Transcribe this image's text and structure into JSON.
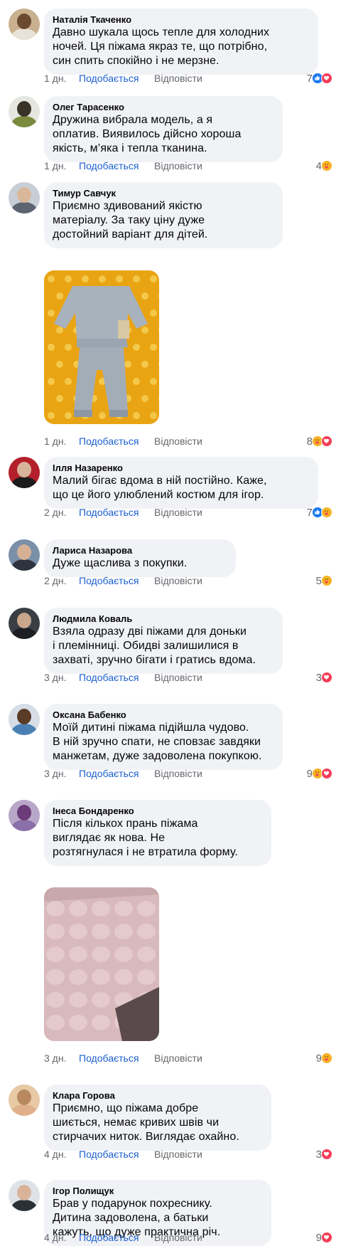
{
  "ui": {
    "like_label": "Подобається",
    "reply_label": "Відповісти"
  },
  "comments": [
    {
      "author": "Наталія Ткаченко",
      "lines": [
        "Давно шукала щось тепле для холодних",
        "ночей. Ця піжама якраз те, що потрібно,",
        "син спить спокійно і не мерзне."
      ],
      "time": "1 дн.",
      "count": "7",
      "reactions": [
        "like-icon",
        "love-icon"
      ],
      "avatar": {
        "bg": "#c9b08f",
        "head": "#6b4a2e",
        "body": "#e8e2d8"
      }
    },
    {
      "author": "Олег Тарасенко",
      "lines": [
        "Дружина вибрала модель, а я",
        "оплатив. Виявилось дійсно хороша",
        "якість, м’яка і тепла тканина."
      ],
      "time": "1 дн.",
      "count": "4",
      "reactions": [
        "care-icon"
      ],
      "avatar": {
        "bg": "#e4e6df",
        "head": "#3a3328",
        "body": "#7b8a3e"
      }
    },
    {
      "author": "Тимур Савчук",
      "lines": [
        "Приємно здивований якістю",
        "матеріалу. За таку ціну дуже",
        "достойний варіант для дітей."
      ],
      "time": "1 дн.",
      "count": "8",
      "reactions": [
        "care-icon",
        "love-icon"
      ],
      "avatar": {
        "bg": "#c7ced6",
        "head": "#d9b79a",
        "body": "#5c6470"
      }
    },
    {
      "author": "Ілля Назаренко",
      "lines": [
        "Малий бігає вдома в ній постійно. Каже,",
        "що це його улюблений костюм для ігор."
      ],
      "time": "2 дн.",
      "count": "7",
      "reactions": [
        "like-icon",
        "care-icon"
      ],
      "avatar": {
        "bg": "#b3202b",
        "head": "#d7b49a",
        "body": "#1c1c1c"
      }
    },
    {
      "author": "Лариса Назарова",
      "lines": [
        "Дуже щаслива з покупки."
      ],
      "time": "2 дн.",
      "count": "5",
      "reactions": [
        "care-icon"
      ],
      "avatar": {
        "bg": "#7a8fa8",
        "head": "#d5b095",
        "body": "#2f3340"
      }
    },
    {
      "author": "Людмила Коваль",
      "lines": [
        "Взяла одразу дві піжами для доньки",
        "і племінниці. Обидві залишилися в",
        "захваті, зручно бігати і гратись вдома."
      ],
      "time": "3 дн.",
      "count": "3",
      "reactions": [
        "love-icon"
      ],
      "avatar": {
        "bg": "#3a3e45",
        "head": "#caa68a",
        "body": "#1d1f24"
      }
    },
    {
      "author": "Оксана Бабенко",
      "lines": [
        "Моїй дитині піжама підійшла чудово.",
        "В ній зручно спати, не сповзає завдяки",
        "манжетам, дуже задоволена покупкою."
      ],
      "time": "3 дн.",
      "count": "9",
      "reactions": [
        "care-icon",
        "love-icon"
      ],
      "avatar": {
        "bg": "#d6dde6",
        "head": "#5a3b26",
        "body": "#4a7fb4"
      }
    },
    {
      "author": "Інеса Бондаренко",
      "lines": [
        "Після кількох прань піжама",
        "виглядає як нова. Не",
        "розтягнулася і не втратила форму."
      ],
      "time": "3 дн.",
      "count": "9",
      "reactions": [
        "care-icon"
      ],
      "avatar": {
        "bg": "#b9a7c9",
        "head": "#6b3b7a",
        "body": "#8b6fa8"
      }
    },
    {
      "author": "Клара Горова",
      "lines": [
        "Приємно, що піжама добре",
        "шиється, немає кривих швів чи",
        "стирчачих ниток. Виглядає охайно."
      ],
      "time": "4 дн.",
      "count": "3",
      "reactions": [
        "love-icon"
      ],
      "avatar": {
        "bg": "#e8c9a6",
        "head": "#b8895e",
        "body": "#e0b08a"
      }
    },
    {
      "author": "Ігор Полищук",
      "lines": [
        "Брав у подарунок похреснику.",
        "Дитина задоволена, а батьки",
        "кажуть, що дуже практична річ."
      ],
      "time": "4 дн.",
      "count": "9",
      "reactions": [
        "love-icon"
      ],
      "avatar": {
        "bg": "#dfe3e8",
        "head": "#d9b49a",
        "body": "#2b2f36"
      }
    }
  ],
  "photos": [
    {
      "after_comment": 2,
      "name": "grey-pajama-photo",
      "kind": "grey"
    },
    {
      "after_comment": 7,
      "name": "pink-pajama-photo",
      "kind": "pink"
    }
  ]
}
